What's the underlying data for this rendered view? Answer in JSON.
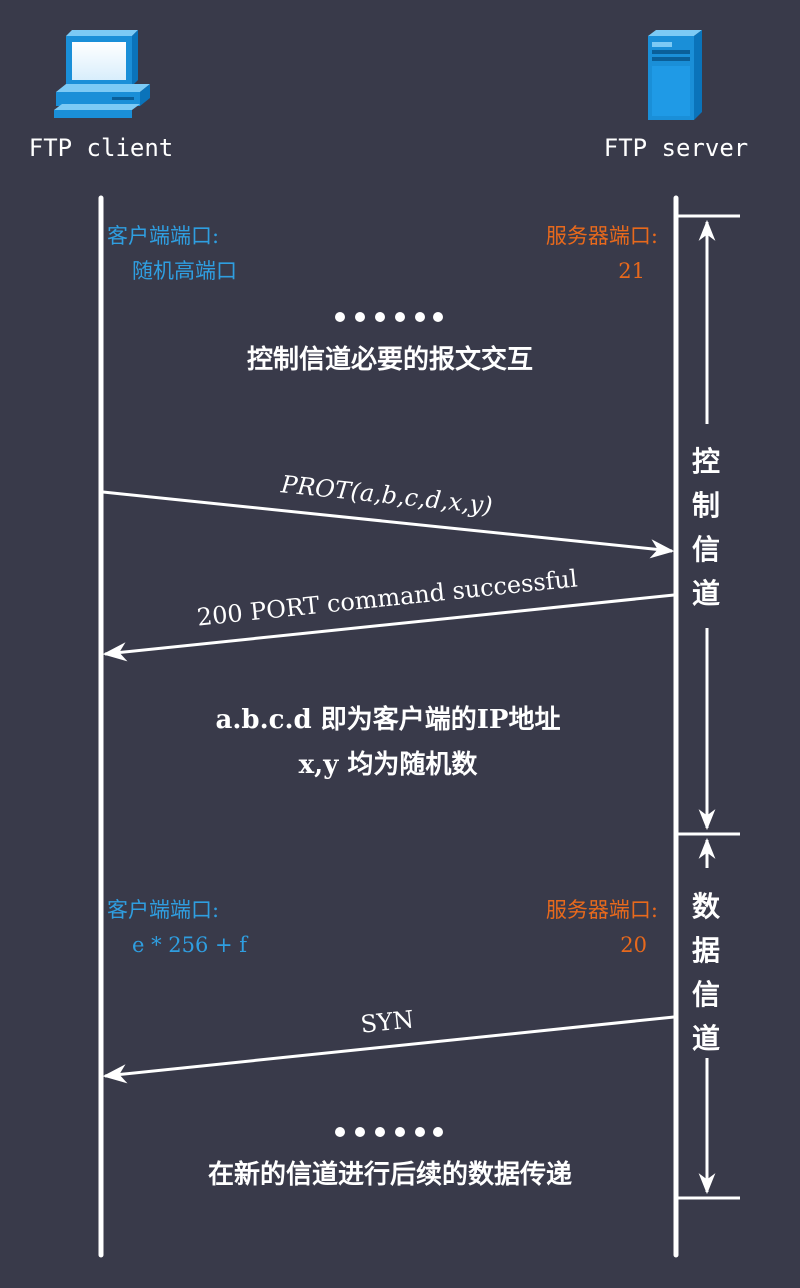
{
  "actors": {
    "client": {
      "label": "FTP client"
    },
    "server": {
      "label": "FTP server"
    }
  },
  "control_phase": {
    "client_port_title": "客户端端口:",
    "client_port_value": "随机高端口",
    "server_port_title": "服务器端口:",
    "server_port_value": "21",
    "ellipsis": "••••••",
    "caption": "控制信道必要的报文交互"
  },
  "messages": [
    {
      "label": "PROT(a,b,c,d,x,y)",
      "direction": "client-to-server"
    },
    {
      "label": "200 PORT command successful",
      "direction": "server-to-client"
    }
  ],
  "note": {
    "line1": "a.b.c.d 即为客户端的IP地址",
    "line2": "x,y 均为随机数"
  },
  "data_phase": {
    "client_port_title": "客户端端口:",
    "client_port_value": "e * 256 + f",
    "server_port_title": "服务器端口:",
    "server_port_value": "20",
    "syn_label": "SYN",
    "ellipsis": "••••••",
    "caption": "在新的信道进行后续的数据传递"
  },
  "channels": {
    "control": [
      "控",
      "制",
      "信",
      "道"
    ],
    "data": [
      "数",
      "据",
      "信",
      "道"
    ]
  },
  "colors": {
    "background": "#393a4a",
    "client_text": "#2f9ee0",
    "server_text": "#e8691c",
    "line": "#ffffff"
  }
}
